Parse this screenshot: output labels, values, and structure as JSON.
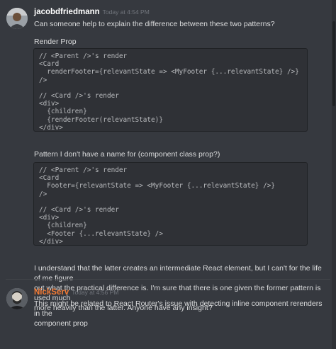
{
  "colors": {
    "background": "#36393f",
    "code_background": "#2f3136",
    "username_primary": "#ffffff",
    "username_secondary": "#f47b35",
    "timestamp": "#72767d",
    "text": "#dcddde"
  },
  "messages": [
    {
      "username": "jacobdfriedmann",
      "timestamp": "Today at 4:54 PM",
      "avatar_icon": "user-avatar-icon",
      "line1": "Can someone help to explain the difference between these two patterns?",
      "label1": "Render Prop",
      "code1": [
        "// <Parent />'s render",
        "<Card",
        "  renderFooter={relevantState => <MyFooter {...relevantState} />}",
        "/>",
        "",
        "// <Card />'s render",
        "<div>",
        "  {children}",
        "  {renderFooter(relevantState)}",
        "</div>"
      ],
      "label2": "Pattern I don't have a name for (component class prop?)",
      "code2": [
        "// <Parent />'s render",
        "<Card",
        "  Footer={relevantState => <MyFooter {...relevantState} />}",
        "/>",
        "",
        "// <Card />'s render",
        "<div>",
        "  {children}",
        "  <Footer {...relevantState} />",
        "</div>"
      ],
      "para_lines": [
        "I understand that the latter creates an intermediate React element, but I can't for the life of me figure",
        "out what the practical difference is. I'm sure that there is one given the former pattern is used much",
        "more heavily than the latter. Anyone have any insight?"
      ]
    },
    {
      "username": "NickServ",
      "timestamp": "Today at 4:56 PM",
      "avatar_icon": "user-avatar-icon",
      "lines": [
        "This might be related to React Router's issue with detecting inline component rerenders in the",
        "component prop"
      ]
    }
  ]
}
